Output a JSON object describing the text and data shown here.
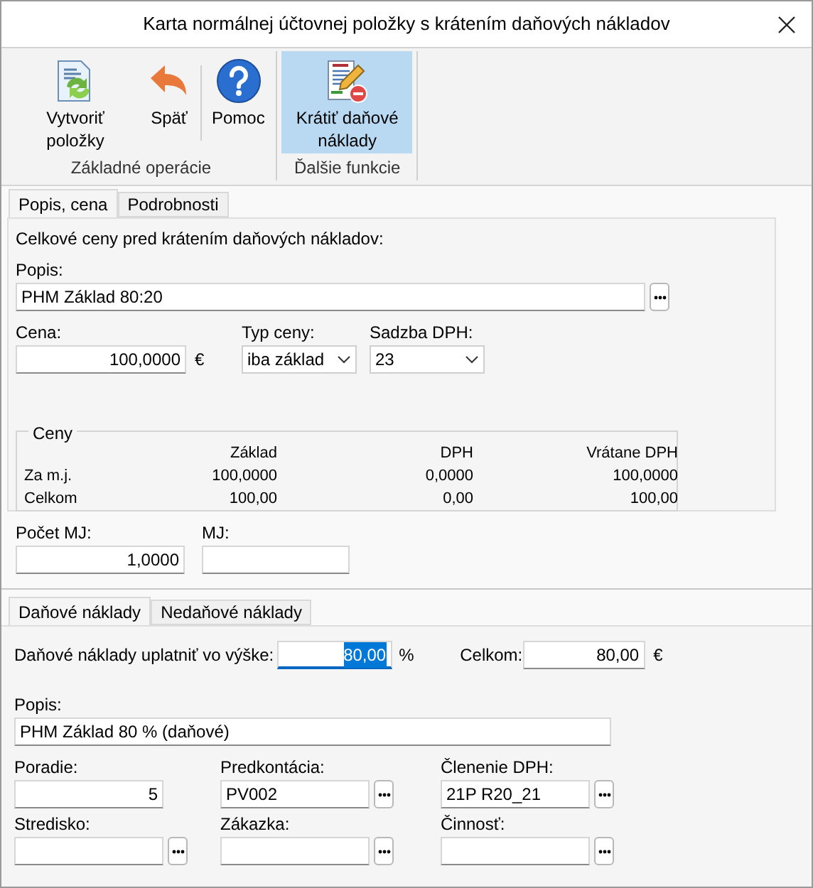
{
  "window": {
    "title": "Karta normálnej účtovnej položky s krátením daňových nákladov"
  },
  "ribbon": {
    "groups": [
      {
        "label": "Základné operácie",
        "sections": [
          [
            {
              "label": "Vytvoriť položky",
              "kind": "refresh",
              "selected": false
            },
            {
              "label": "Späť",
              "kind": "undo",
              "selected": false
            }
          ],
          [
            {
              "label": "Pomoc",
              "kind": "help",
              "selected": false
            }
          ]
        ]
      },
      {
        "label": "Ďalšie funkcie",
        "sections": [
          [
            {
              "label": "Krátiť daňové náklady",
              "kind": "edit",
              "selected": true
            }
          ]
        ]
      }
    ]
  },
  "upper_tabs": [
    {
      "label": "Popis, cena",
      "selected": true
    },
    {
      "label": "Podrobnosti",
      "selected": false
    }
  ],
  "top_panel": {
    "heading": "Celkové ceny pred krátením daňových nákladov:",
    "popis": {
      "label": "Popis:",
      "value": "PHM Základ 80:20"
    },
    "cena": {
      "label": "Cena:",
      "value": "100,0000",
      "unit": "€"
    },
    "typ_ceny": {
      "label": "Typ ceny:",
      "value": "iba základ"
    },
    "sadzba_dph": {
      "label": "Sadzba DPH:",
      "value": "23"
    },
    "ceny": {
      "title": "Ceny",
      "columns": [
        "Základ",
        "DPH",
        "Vrátane DPH"
      ],
      "rows": [
        {
          "label": "Za m.j.",
          "values": [
            "100,0000",
            "0,0000",
            "100,0000"
          ]
        },
        {
          "label": "Celkom",
          "values": [
            "100,00",
            "0,00",
            "100,00"
          ]
        }
      ]
    }
  },
  "quantity": {
    "pocet_mj": {
      "label": "Počet MJ:",
      "value": "1,0000"
    },
    "mj": {
      "label": "MJ:"
    }
  },
  "lower_tabs": [
    {
      "label": "Daňové náklady",
      "selected": true
    },
    {
      "label": "Nedaňové náklady",
      "selected": false
    }
  ],
  "lower_panel": {
    "rate": {
      "label": "Daňové náklady uplatniť vo výške:",
      "value": "80,00",
      "unit": "%",
      "focused": true
    },
    "celkom": {
      "label": "Celkom:",
      "value": "80,00",
      "unit": "€"
    },
    "popis": {
      "label": "Popis:",
      "value": "PHM Základ 80 % (daňové)"
    },
    "fields": [
      {
        "label": "Poradie:",
        "value": "5",
        "kind": "number",
        "browse": false
      },
      {
        "label": "Predkontácia:",
        "value": "PV002",
        "kind": "text",
        "browse": true
      },
      {
        "label": "Členenie DPH:",
        "value": "21P R20_21",
        "kind": "text",
        "browse": true
      },
      {
        "label": "Stredisko:",
        "browse": true
      },
      {
        "label": "Zákazka:",
        "browse": true
      },
      {
        "label": "Činnosť:",
        "browse": true
      }
    ]
  }
}
